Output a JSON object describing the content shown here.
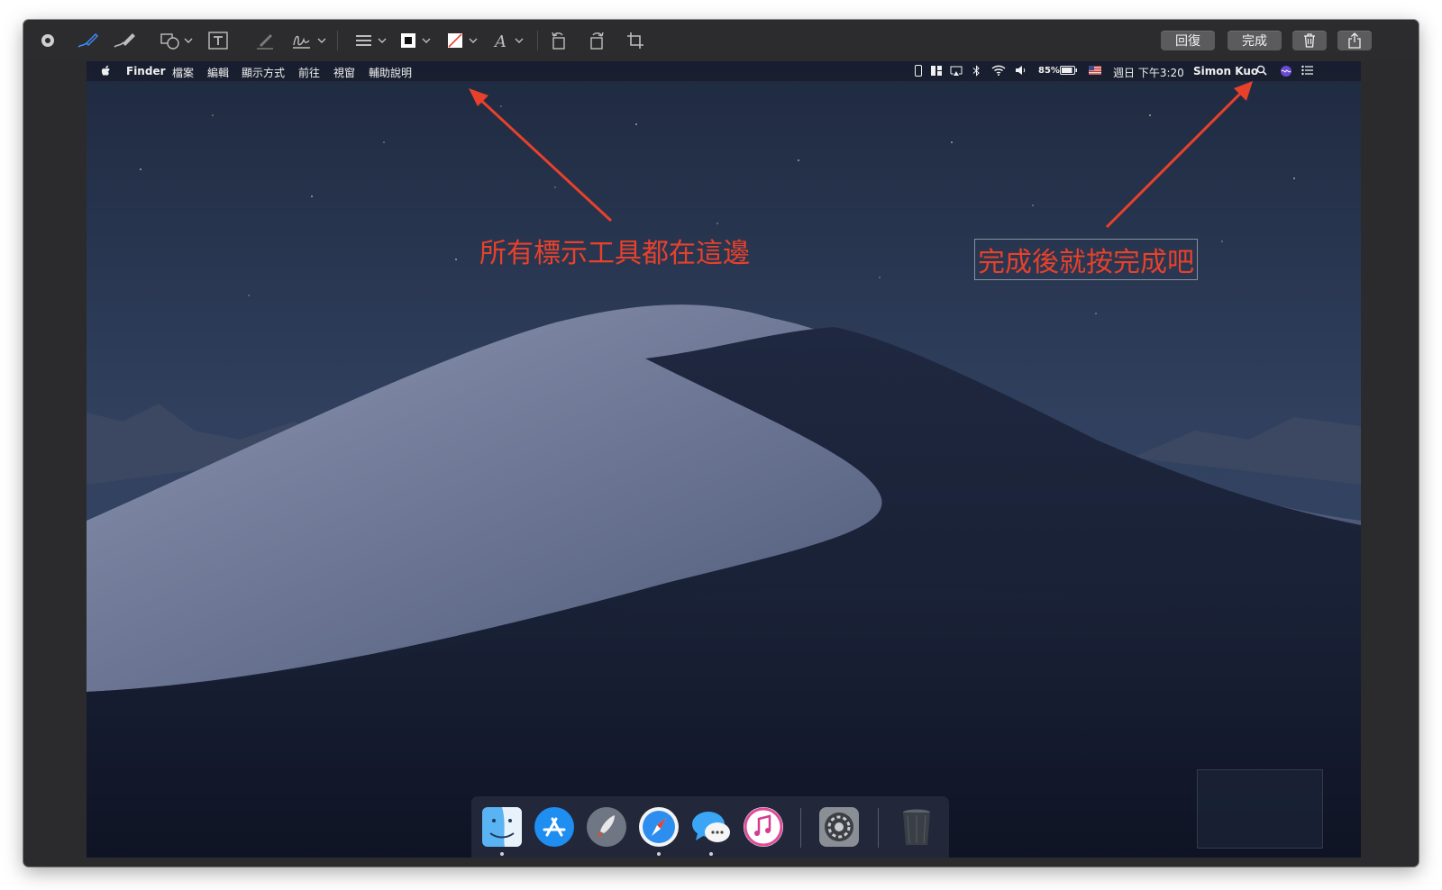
{
  "toolbar": {
    "revert_label": "回復",
    "done_label": "完成",
    "icons": [
      "record-dot-icon",
      "sketch-pen-icon",
      "draw-brush-icon",
      "shapes-icon",
      "text-box-icon",
      "highlight-icon",
      "signature-icon",
      "line-style-icon",
      "border-color-icon",
      "fill-color-icon",
      "text-style-icon",
      "rotate-left-icon",
      "rotate-right-icon",
      "crop-icon",
      "trash-icon",
      "share-icon"
    ]
  },
  "menubar": {
    "apple": "",
    "app_name": "Finder",
    "menus": [
      "檔案",
      "編輯",
      "顯示方式",
      "前往",
      "視窗",
      "輔助說明"
    ],
    "battery": "85%",
    "clock": "週日 下午3:20",
    "user": "Simon Kuo"
  },
  "annotations": {
    "tools_note": "所有標示工具都在這邊",
    "done_note": "完成後就按完成吧"
  },
  "dock": {
    "apps": [
      "Finder",
      "App Store",
      "Launchpad",
      "Safari",
      "Messages",
      "iTunes",
      "System Preferences",
      "Trash"
    ]
  },
  "colors": {
    "annotation_red": "#e8412b",
    "toolbar_bg": "#2c2c2e",
    "accent_blue": "#3f8cff"
  }
}
